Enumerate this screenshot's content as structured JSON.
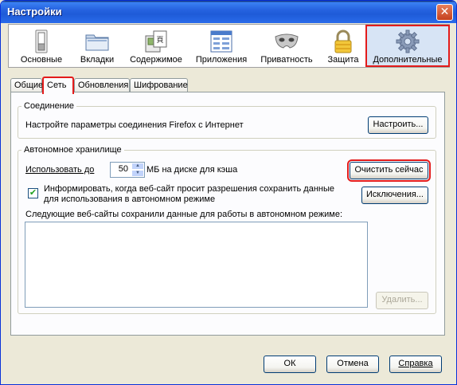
{
  "window": {
    "title": "Настройки",
    "close_icon": "close-icon"
  },
  "toolbar": {
    "items": [
      {
        "label": "Основные",
        "icon": "switch-icon"
      },
      {
        "label": "Вкладки",
        "icon": "folder-tabs-icon"
      },
      {
        "label": "Содержимое",
        "icon": "content-icon"
      },
      {
        "label": "Приложения",
        "icon": "applications-icon"
      },
      {
        "label": "Приватность",
        "icon": "mask-icon"
      },
      {
        "label": "Защита",
        "icon": "padlock-icon"
      },
      {
        "label": "Дополнительные",
        "icon": "gear-icon",
        "selected": true
      }
    ]
  },
  "tabs": [
    {
      "label": "Общие"
    },
    {
      "label": "Сеть",
      "active": true
    },
    {
      "label": "Обновления"
    },
    {
      "label": "Шифрование"
    }
  ],
  "connection": {
    "legend": "Соединение",
    "text": "Настройте параметры соединения Firefox с Интернет",
    "button": "Настроить..."
  },
  "offline": {
    "legend": "Автономное хранилище",
    "use_label": "Использовать до",
    "cache_value": "50",
    "cache_suffix": "МБ на диске для кэша",
    "clear_button": "Очистить сейчас",
    "notify_line1": "Информировать, когда веб-сайт просит разрешения сохранить данные",
    "notify_line2": "для использования в автономном режиме",
    "notify_checked": true,
    "exceptions_button": "Исключения...",
    "sites_label": "Следующие веб-сайты сохранили данные для работы в автономном режиме:",
    "remove_button": "Удалить..."
  },
  "footer": {
    "ok": "ОК",
    "cancel": "Отмена",
    "help": "Справка"
  },
  "colors": {
    "highlight": "#E31B1B",
    "titlebar": "#2663E0",
    "face": "#ECE9D8"
  }
}
